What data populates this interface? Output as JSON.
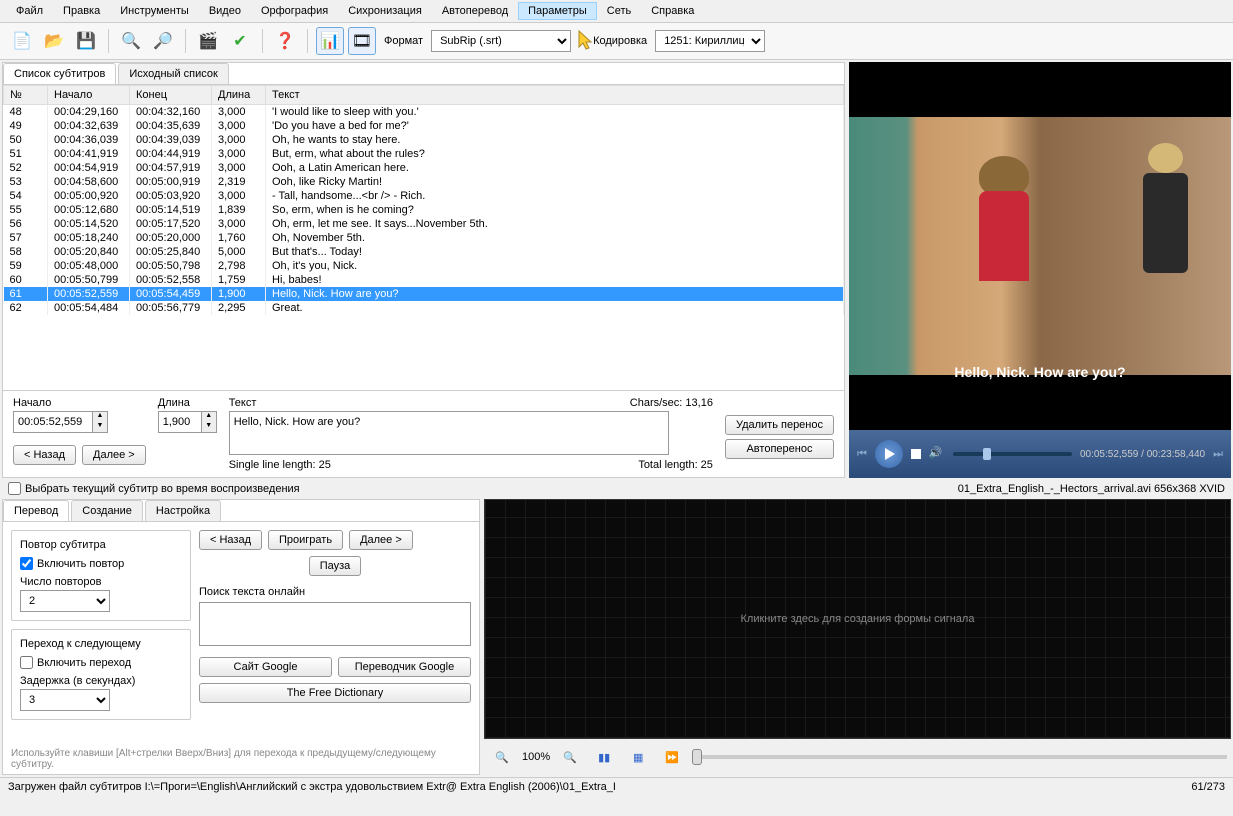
{
  "menu": [
    "Файл",
    "Правка",
    "Инструменты",
    "Видео",
    "Орфография",
    "Сихронизация",
    "Автоперевод",
    "Параметры",
    "Сеть",
    "Справка"
  ],
  "menu_active": 7,
  "toolbar": {
    "format_label": "Формат",
    "format_value": "SubRip (.srt)",
    "encoding_label": "Кодировка",
    "encoding_value": "1251: Кириллица ("
  },
  "tabs": {
    "list": "Список субтитров",
    "source": "Исходный список"
  },
  "columns": {
    "no": "№",
    "start": "Начало",
    "end": "Конец",
    "dur": "Длина",
    "text": "Текст"
  },
  "rows": [
    {
      "n": "48",
      "s": "00:04:29,160",
      "e": "00:04:32,160",
      "d": "3,000",
      "t": "'I would like to sleep with you.'"
    },
    {
      "n": "49",
      "s": "00:04:32,639",
      "e": "00:04:35,639",
      "d": "3,000",
      "t": "'Do you have a bed for me?'"
    },
    {
      "n": "50",
      "s": "00:04:36,039",
      "e": "00:04:39,039",
      "d": "3,000",
      "t": "Oh, he wants to stay here."
    },
    {
      "n": "51",
      "s": "00:04:41,919",
      "e": "00:04:44,919",
      "d": "3,000",
      "t": "But, erm, what about the rules?"
    },
    {
      "n": "52",
      "s": "00:04:54,919",
      "e": "00:04:57,919",
      "d": "3,000",
      "t": "Ooh, a Latin American here."
    },
    {
      "n": "53",
      "s": "00:04:58,600",
      "e": "00:05:00,919",
      "d": "2,319",
      "t": "Ooh, like Ricky Martin!"
    },
    {
      "n": "54",
      "s": "00:05:00,920",
      "e": "00:05:03,920",
      "d": "3,000",
      "t": "- Tall, handsome...<br /> - Rich."
    },
    {
      "n": "55",
      "s": "00:05:12,680",
      "e": "00:05:14,519",
      "d": "1,839",
      "t": "So, erm, when is he coming?"
    },
    {
      "n": "56",
      "s": "00:05:14,520",
      "e": "00:05:17,520",
      "d": "3,000",
      "t": "Oh, erm, let me see. It says...November 5th."
    },
    {
      "n": "57",
      "s": "00:05:18,240",
      "e": "00:05:20,000",
      "d": "1,760",
      "t": "Oh, November 5th."
    },
    {
      "n": "58",
      "s": "00:05:20,840",
      "e": "00:05:25,840",
      "d": "5,000",
      "t": "But that's... Today!"
    },
    {
      "n": "59",
      "s": "00:05:48,000",
      "e": "00:05:50,798",
      "d": "2,798",
      "t": "Oh, it's you, Nick."
    },
    {
      "n": "60",
      "s": "00:05:50,799",
      "e": "00:05:52,558",
      "d": "1,759",
      "t": "Hi, babes!"
    },
    {
      "n": "61",
      "s": "00:05:52,559",
      "e": "00:05:54,459",
      "d": "1,900",
      "t": "Hello, Nick. How are you?",
      "sel": true
    },
    {
      "n": "62",
      "s": "00:05:54,484",
      "e": "00:05:56,779",
      "d": "2,295",
      "t": "Great."
    }
  ],
  "editor": {
    "start_label": "Начало",
    "start": "00:05:52,559",
    "dur_label": "Длина",
    "dur": "1,900",
    "text_label": "Текст",
    "text": "Hello, Nick. How are you?",
    "cps_label": "Chars/sec: 13,16",
    "del_wrap": "Удалить перенос",
    "auto_wrap": "Автоперенос",
    "back": "< Назад",
    "next": "Далее >",
    "single_len": "Single line length:  25",
    "total_len": "Total length:  25"
  },
  "video": {
    "subtitle": "Hello, Nick. How are you?",
    "time": "00:05:52,559 / 00:23:58,440"
  },
  "mid": {
    "select_current": "Выбрать текущий субтитр во время воспроизведения",
    "file": "01_Extra_English_-_Hectors_arrival.avi 656x368 XVID"
  },
  "bottom_tabs": [
    "Перевод",
    "Создание",
    "Настройка"
  ],
  "panel": {
    "repeat_title": "Повтор субтитра",
    "enable_repeat": "Включить повтор",
    "repeat_count_label": "Число повторов",
    "repeat_count": "2",
    "goto_title": "Переход к следующему",
    "enable_goto": "Включить переход",
    "delay_label": "Задержка (в секундах)",
    "delay": "3",
    "back": "< Назад",
    "play": "Проиграть",
    "next": "Далее >",
    "pause": "Пауза",
    "search_label": "Поиск текста онлайн",
    "google_site": "Сайт Google",
    "google_tr": "Переводчик Google",
    "freedict": "The Free Dictionary",
    "hint": "Используйте клавиши [Alt+стрелки Вверх/Вниз] для перехода к предыдущему/следующему субтитру."
  },
  "waveform_hint": "Кликните здесь для создания формы сигнала",
  "zoom": "100%",
  "status": {
    "file": "Загружен файл субтитров I:\\=Проги=\\English\\Английский с экстра удовольствием  Extr@  Extra English (2006)\\01_Extra_I",
    "pos": "61/273"
  }
}
